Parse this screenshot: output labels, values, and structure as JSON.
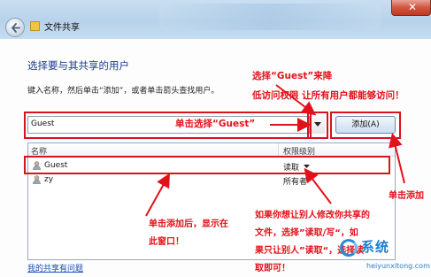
{
  "window": {
    "title": "文件共享",
    "close_glyph": "✕"
  },
  "main": {
    "heading": "选择要与其共享的用户",
    "instruction": "键入名称，然后单击“添加”，或者单击箭头查找用户。",
    "combo_value": "Guest",
    "add_button": "添加(A)",
    "columns": {
      "name": "名称",
      "permission": "权限级别"
    },
    "rows": [
      {
        "name": "Guest",
        "permission": "读取"
      },
      {
        "name": "zy",
        "permission": "所有者"
      }
    ],
    "help_link": "我的共享有问题"
  },
  "annotations": {
    "top": [
      "选择“Guest”来降",
      "低访问权限 让所有用户都能够访问！"
    ],
    "middle": "单击选择“Guest”",
    "right": "单击添加",
    "left": [
      "单击添加后，显示在",
      "此窗口！"
    ],
    "bottom": [
      "如果你想让别人修改你共享的",
      "文件，选择”读取/写“，如",
      "果只让别人”读取“，选择读",
      "取即可！"
    ]
  },
  "watermark": {
    "title": "系统",
    "url": "heiyunxitong.com"
  },
  "colors": {
    "annotation": "#e3111a",
    "heading": "#1d3d8e",
    "link": "#1a4fb5",
    "close": "#c0391f"
  },
  "icons": [
    "back-arrow-icon",
    "file-share-icon",
    "close-icon",
    "dropdown-arrow-icon",
    "user-icon",
    "watermark-logo-icon"
  ]
}
